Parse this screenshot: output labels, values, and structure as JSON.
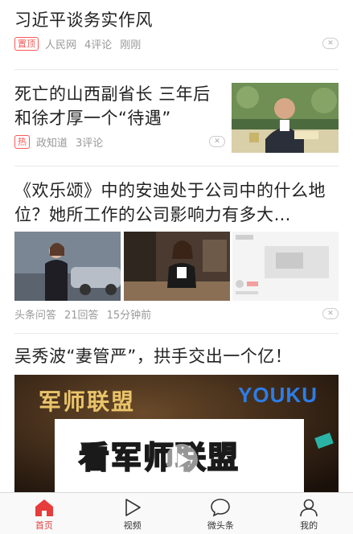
{
  "feed": {
    "items": [
      {
        "title": "习近平谈务实作风",
        "tag": "置顶",
        "source": "人民网",
        "comments": "4评论",
        "time": "刚刚"
      },
      {
        "title": "死亡的山西副省长 三年后和徐才厚一个“待遇”",
        "tag": "热",
        "source": "政知道",
        "comments": "3评论"
      },
      {
        "title": "《欢乐颂》中的安迪处于公司中的什么地位？她所工作的公司影响力有多大…",
        "source": "头条问答",
        "comments": "21回答",
        "time": "15分钟前"
      },
      {
        "title": "吴秀波“妻管严”，拱手交出一个亿！",
        "video_brand": "YOUKU",
        "video_show": "军师联盟",
        "video_banner": "看军师联盟"
      }
    ],
    "dislike_glyph": "✕"
  },
  "tabbar": {
    "tabs": [
      {
        "label": "首页",
        "icon": "home-icon",
        "active": true
      },
      {
        "label": "视频",
        "icon": "play-icon"
      },
      {
        "label": "微头条",
        "icon": "chat-bubble-icon"
      },
      {
        "label": "我的",
        "icon": "user-icon"
      }
    ]
  },
  "colors": {
    "accent": "#e63c3c",
    "tag_red": "#f85959",
    "meta_gray": "#999999",
    "divider": "#e8e8e8"
  }
}
